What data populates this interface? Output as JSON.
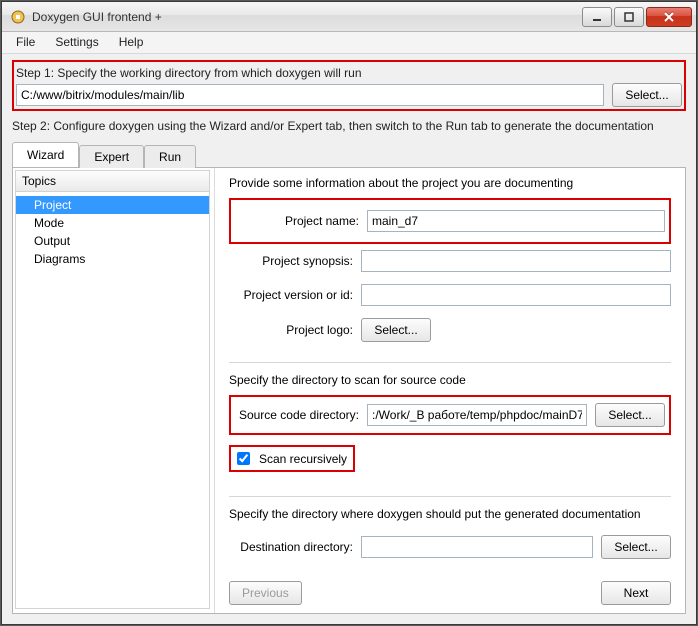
{
  "window": {
    "title": "Doxygen GUI frontend +"
  },
  "menu": {
    "file": "File",
    "settings": "Settings",
    "help": "Help"
  },
  "step1": {
    "label": "Step 1: Specify the working directory from which doxygen will run",
    "path": "C:/www/bitrix/modules/main/lib",
    "select": "Select..."
  },
  "step2": {
    "label": "Step 2: Configure doxygen using the Wizard and/or Expert tab, then switch to the Run tab to generate the documentation"
  },
  "tabs": {
    "wizard": "Wizard",
    "expert": "Expert",
    "run": "Run"
  },
  "topics": {
    "header": "Topics",
    "items": [
      "Project",
      "Mode",
      "Output",
      "Diagrams"
    ],
    "selected_index": 0
  },
  "form": {
    "intro": "Provide some information about the project you are documenting",
    "project_name_label": "Project name:",
    "project_name_value": "main_d7",
    "project_synopsis_label": "Project synopsis:",
    "project_synopsis_value": "",
    "project_version_label": "Project version or id:",
    "project_version_value": "",
    "project_logo_label": "Project logo:",
    "logo_select": "Select...",
    "source_section": "Specify the directory to scan for source code",
    "source_dir_label": "Source code directory:",
    "source_dir_value": ":/Work/_В работе/temp/phpdoc/mainD7",
    "source_select": "Select...",
    "scan_recursive_label": "Scan recursively",
    "scan_recursive_checked": true,
    "dest_section": "Specify the directory where doxygen should put the generated documentation",
    "dest_dir_label": "Destination directory:",
    "dest_dir_value": "",
    "dest_select": "Select...",
    "prev": "Previous",
    "next": "Next"
  }
}
